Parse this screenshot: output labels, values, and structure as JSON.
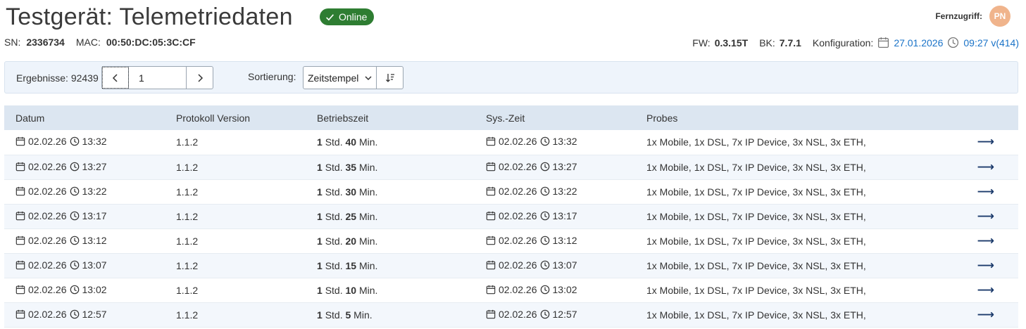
{
  "page": {
    "title": "Testgerät: Telemetriedaten",
    "status": "Online",
    "remote_label": "Fernzugriff:",
    "avatar_initials": "PN"
  },
  "device": {
    "sn_label": "SN:",
    "sn": "2336734",
    "mac_label": "MAC:",
    "mac": "00:50:DC:05:3C:CF",
    "fw_label": "FW:",
    "fw": "0.3.15T",
    "bk_label": "BK:",
    "bk": "7.7.1",
    "config_label": "Konfiguration:",
    "config_date": "27.01.2026",
    "config_time": "09:27 v(414)"
  },
  "toolbar": {
    "results_label": "Ergebnisse: 92439",
    "page": "1",
    "sort_label": "Sortierung:",
    "sort_value": "Zeitstempel"
  },
  "table": {
    "headers": [
      "Datum",
      "Protokoll Version",
      "Betriebszeit",
      "Sys.-Zeit",
      "Probes"
    ],
    "rows": [
      {
        "date": "02.02.26",
        "time": "13:32",
        "version": "1.1.2",
        "h": "1",
        "m": "40",
        "sys_date": "02.02.26",
        "sys_time": "13:32",
        "probes": "1x Mobile, 1x DSL, 7x IP Device, 3x NSL, 3x ETH,"
      },
      {
        "date": "02.02.26",
        "time": "13:27",
        "version": "1.1.2",
        "h": "1",
        "m": "35",
        "sys_date": "02.02.26",
        "sys_time": "13:27",
        "probes": "1x Mobile, 1x DSL, 7x IP Device, 3x NSL, 3x ETH,"
      },
      {
        "date": "02.02.26",
        "time": "13:22",
        "version": "1.1.2",
        "h": "1",
        "m": "30",
        "sys_date": "02.02.26",
        "sys_time": "13:22",
        "probes": "1x Mobile, 1x DSL, 7x IP Device, 3x NSL, 3x ETH,"
      },
      {
        "date": "02.02.26",
        "time": "13:17",
        "version": "1.1.2",
        "h": "1",
        "m": "25",
        "sys_date": "02.02.26",
        "sys_time": "13:17",
        "probes": "1x Mobile, 1x DSL, 7x IP Device, 3x NSL, 3x ETH,"
      },
      {
        "date": "02.02.26",
        "time": "13:12",
        "version": "1.1.2",
        "h": "1",
        "m": "20",
        "sys_date": "02.02.26",
        "sys_time": "13:12",
        "probes": "1x Mobile, 1x DSL, 7x IP Device, 3x NSL, 3x ETH,"
      },
      {
        "date": "02.02.26",
        "time": "13:07",
        "version": "1.1.2",
        "h": "1",
        "m": "15",
        "sys_date": "02.02.26",
        "sys_time": "13:07",
        "probes": "1x Mobile, 1x DSL, 7x IP Device, 3x NSL, 3x ETH,"
      },
      {
        "date": "02.02.26",
        "time": "13:02",
        "version": "1.1.2",
        "h": "1",
        "m": "10",
        "sys_date": "02.02.26",
        "sys_time": "13:02",
        "probes": "1x Mobile, 1x DSL, 7x IP Device, 3x NSL, 3x ETH,"
      },
      {
        "date": "02.02.26",
        "time": "12:57",
        "version": "1.1.2",
        "h": "1",
        "m": "5",
        "sys_date": "02.02.26",
        "sys_time": "12:57",
        "probes": "1x Mobile, 1x DSL, 7x IP Device, 3x NSL, 3x ETH,"
      }
    ],
    "std_label": "Std.",
    "min_label": "Min.",
    "row_action_icon": "arrow-right-icon"
  },
  "colors": {
    "online": "#2e7d32",
    "link": "#1a73c8",
    "avatar": "#f0b48c",
    "table_header": "#dce6f1",
    "toolbar_bg": "#eef4fb"
  }
}
